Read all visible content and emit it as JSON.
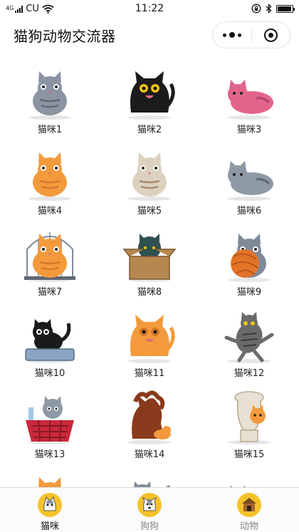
{
  "status_bar": {
    "signal_text": "4G",
    "carrier": "CU",
    "time": "11:22",
    "battery_level": 0.95
  },
  "nav": {
    "title": "猫狗动物交流器"
  },
  "grid_items": [
    {
      "label": "猫咪1",
      "body": "#8a94a3",
      "accent": "#5f6773",
      "pose": "sit"
    },
    {
      "label": "猫咪2",
      "body": "#1b1b1b",
      "accent": "#f2c21b",
      "pose": "hiss"
    },
    {
      "label": "猫咪3",
      "body": "#e2648a",
      "accent": "#b0416a",
      "pose": "lie"
    },
    {
      "label": "猫咪4",
      "body": "#f39a3c",
      "accent": "#d5782a",
      "pose": "sit"
    },
    {
      "label": "猫咪5",
      "body": "#ddd1bf",
      "accent": "#a58a6e",
      "pose": "sit"
    },
    {
      "label": "猫咪6",
      "body": "#8e99a6",
      "accent": "#5f6773",
      "pose": "lie"
    },
    {
      "label": "猫咪7",
      "body": "#f39a3c",
      "accent": "#d5782a",
      "pose": "cage"
    },
    {
      "label": "猫咪8",
      "body": "#2f5250",
      "accent": "#b58850",
      "pose": "box"
    },
    {
      "label": "猫咪9",
      "body": "#7f8a98",
      "accent": "#e2742a",
      "pose": "yarn"
    },
    {
      "label": "猫咪10",
      "body": "#1b1b1b",
      "accent": "#8aa4c2",
      "pose": "tray"
    },
    {
      "label": "猫咪11",
      "body": "#f39a3c",
      "accent": "#d5782a",
      "pose": "hiss"
    },
    {
      "label": "猫咪12",
      "body": "#6a6a6a",
      "accent": "#3a3a3a",
      "pose": "jump"
    },
    {
      "label": "猫咪13",
      "body": "#8e99a6",
      "accent": "#c9283a",
      "pose": "basket"
    },
    {
      "label": "猫咪14",
      "body": "#8a3a1c",
      "accent": "#f39a3c",
      "pose": "shadow"
    },
    {
      "label": "猫咪15",
      "body": "#e8e0d2",
      "accent": "#f39a3c",
      "pose": "toilet"
    },
    {
      "label": "",
      "body": "#f39a3c",
      "accent": "#1b1b1b",
      "pose": "sit"
    },
    {
      "label": "",
      "body": "#7f8a98",
      "accent": "#5f6773",
      "pose": "tray"
    },
    {
      "label": "",
      "body": "#5f6773",
      "accent": "#3a3a3a",
      "pose": "lie"
    }
  ],
  "tabs": [
    {
      "label": "猫咪",
      "icon": "cat-icon",
      "color": "#111111"
    },
    {
      "label": "狗狗",
      "icon": "dog-icon",
      "color": "#888888"
    },
    {
      "label": "动物",
      "icon": "animal-house-icon",
      "color": "#888888"
    }
  ],
  "colors": {
    "accent": "#f5c22a",
    "tab_active": "#111111",
    "tab_inactive": "#888888"
  }
}
